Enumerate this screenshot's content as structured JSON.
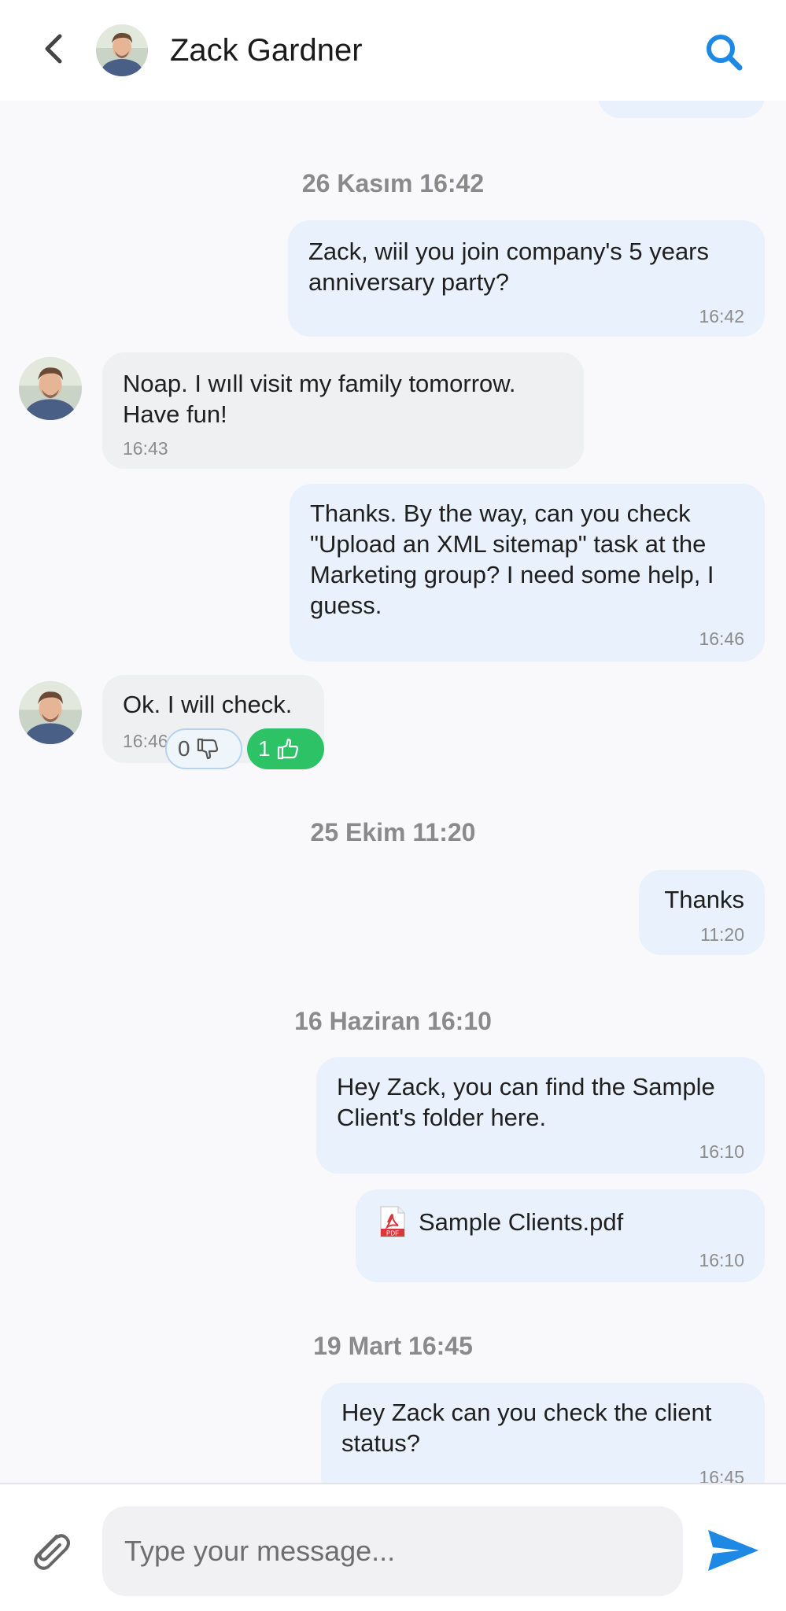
{
  "header": {
    "back_icon": "chevron-left-icon",
    "contact_name": "Zack Gardner",
    "search_icon": "search-icon",
    "accent_color": "#1e88e5"
  },
  "messages": [
    {
      "date": "26 Kasım 16:42"
    },
    {
      "direction": "out",
      "text": "Zack, wiil you join company's 5 years\nanniversary party?",
      "time": "16:42"
    },
    {
      "direction": "in",
      "text": "Noap. I wıll visit my family tomorrow.\nHave fun!",
      "time": "16:43"
    },
    {
      "direction": "out",
      "text": "Thanks. By the way, can you check\n\"Upload an XML sitemap\" task at the\nMarketing group? I need some help, I\nguess.",
      "time": "16:46"
    },
    {
      "direction": "in",
      "text": "Ok. I will check.",
      "time": "16:46",
      "reactions": {
        "dislike_count": "0",
        "like_count": "1"
      }
    },
    {
      "date": "25 Ekim 11:20"
    },
    {
      "direction": "out",
      "text": "Thanks",
      "time": "11:20"
    },
    {
      "date": "16 Haziran 16:10"
    },
    {
      "direction": "out",
      "text": "Hey Zack, you can find the Sample\nClient's folder here.",
      "time": "16:10"
    },
    {
      "direction": "out",
      "file_name": "Sample Clients.pdf",
      "file_icon": "pdf-file-icon",
      "time": "16:10"
    },
    {
      "date": "19 Mart 16:45"
    },
    {
      "direction": "out",
      "text": "Hey Zack can you check the client\nstatus?",
      "time": "16:45"
    }
  ],
  "composer": {
    "placeholder": "Type your message...",
    "attach_icon": "paperclip-icon",
    "send_icon": "send-icon"
  },
  "colors": {
    "outgoing_bubble": "#e8f1fc",
    "incoming_bubble": "#eff0f2",
    "like_reaction": "#2ec266",
    "send_button": "#1e88e5"
  }
}
